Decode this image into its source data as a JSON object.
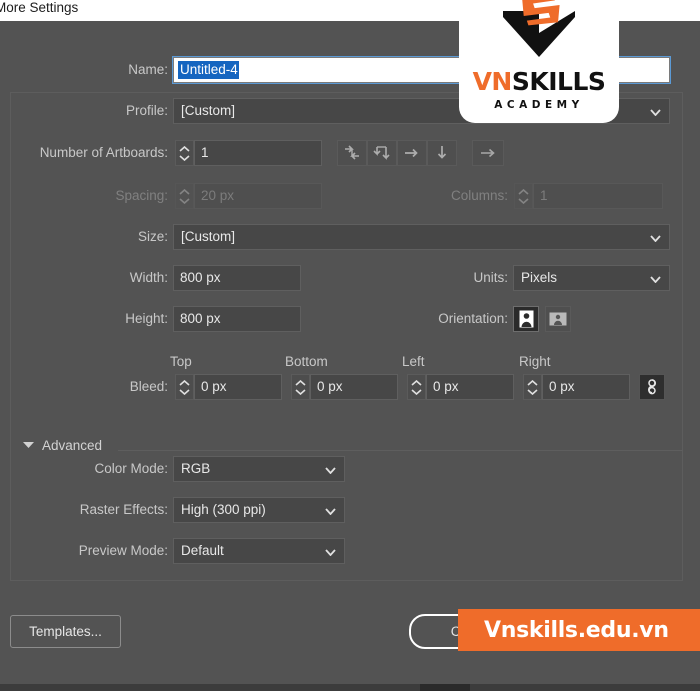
{
  "window": {
    "more_settings_label": "More Settings"
  },
  "form": {
    "name": {
      "label": "Name:",
      "value": "Untitled-4"
    },
    "profile": {
      "label": "Profile:",
      "value": "[Custom]"
    },
    "artboards": {
      "label": "Number of Artboards:",
      "value": "1",
      "arrange_icons": [
        "grid-by-row-icon",
        "grid-by-column-icon",
        "arrange-by-row-icon",
        "arrange-by-column-icon"
      ],
      "direction_icon": "right-to-left-icon"
    },
    "spacing": {
      "label": "Spacing:",
      "value": "20 px",
      "disabled": true
    },
    "columns": {
      "label": "Columns:",
      "value": "1",
      "disabled": true
    },
    "size": {
      "label": "Size:",
      "value": "[Custom]"
    },
    "width": {
      "label": "Width:",
      "value": "800 px"
    },
    "height": {
      "label": "Height:",
      "value": "800 px"
    },
    "units": {
      "label": "Units:",
      "value": "Pixels"
    },
    "orientation": {
      "label": "Orientation:",
      "portrait_icon": "portrait-orientation-icon",
      "landscape_icon": "landscape-orientation-icon",
      "selected": "portrait"
    },
    "bleed": {
      "label": "Bleed:",
      "top_label": "Top",
      "bottom_label": "Bottom",
      "left_label": "Left",
      "right_label": "Right",
      "top_value": "0 px",
      "bottom_value": "0 px",
      "left_value": "0 px",
      "right_value": "0 px",
      "link_icon": "link-chain-icon"
    }
  },
  "advanced": {
    "label": "Advanced",
    "expanded": true,
    "color_mode": {
      "label": "Color Mode:",
      "value": "RGB"
    },
    "raster_effects": {
      "label": "Raster Effects:",
      "value": "High (300 ppi)"
    },
    "preview_mode": {
      "label": "Preview Mode:",
      "value": "Default"
    }
  },
  "footer": {
    "templates_label": "Templates...",
    "create_label": "Create"
  },
  "overlay": {
    "logo": {
      "word_vn": "VN",
      "word_skills": "SKILLS",
      "subtitle": "ACADEMY"
    },
    "banner": {
      "text": "Vnskills.edu.vn"
    }
  },
  "colors": {
    "accent_orange": "#ef6c2a",
    "panel_bg": "#535353",
    "field_bg": "#474747",
    "selection_blue": "#1565c0"
  }
}
